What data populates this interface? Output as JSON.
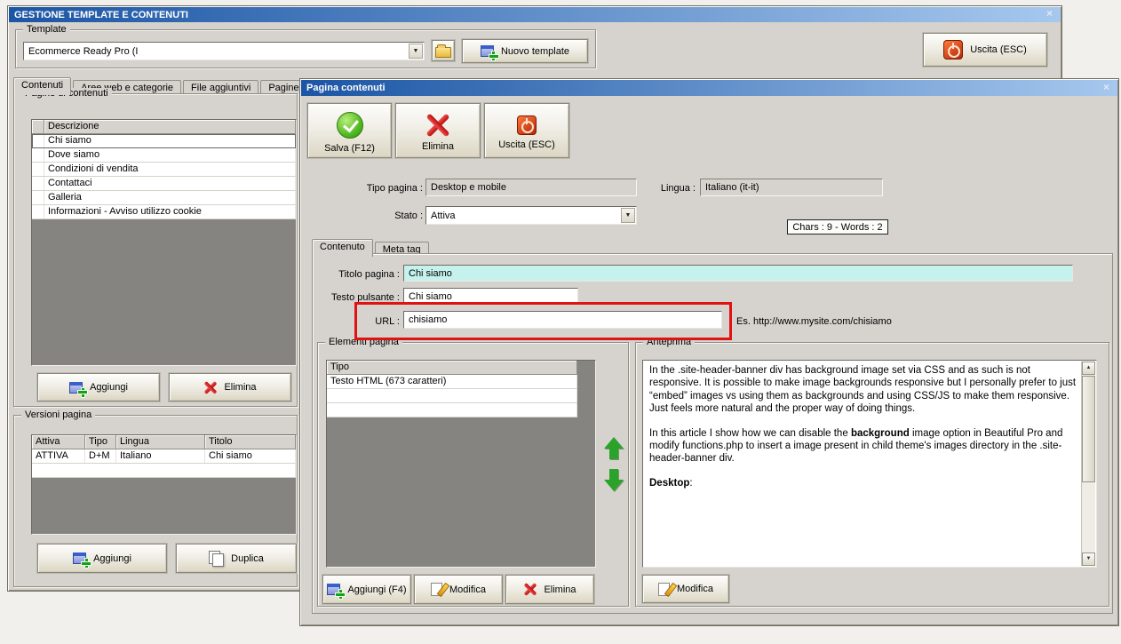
{
  "icons": {
    "close": "×",
    "dropdown": "▼",
    "scroll_up": "▲",
    "scroll_down": "▼"
  },
  "window": {
    "title": "GESTIONE TEMPLATE E CONTENUTI",
    "template": {
      "group_label": "Template",
      "combo_value": "Ecommerce Ready Pro (I",
      "nuovo_button": "Nuovo template",
      "uscita_button": "Uscita (ESC)"
    },
    "tabs": [
      "Contenuti",
      "Aree web e categorie",
      "File aggiuntivi",
      "Pagine di c"
    ],
    "pagine": {
      "group_label": "Pagine di contenuti",
      "col_descrizione": "Descrizione",
      "rows": [
        "Chi siamo",
        "Dove siamo",
        "Condizioni di vendita",
        "Contattaci",
        "Galleria",
        "Informazioni - Avviso utilizzo cookie"
      ],
      "aggiungi_button": "Aggiungi",
      "elimina_button": "Elimina"
    },
    "versioni": {
      "group_label": "Versioni pagina",
      "cols": [
        "Attiva",
        "Tipo",
        "Lingua",
        "Titolo"
      ],
      "row": [
        "ATTIVA",
        "D+M",
        "Italiano",
        "Chi siamo"
      ],
      "aggiungi_button": "Aggiungi",
      "duplica_button": "Duplica"
    }
  },
  "dialog": {
    "title": "Pagina contenuti",
    "toolbar": {
      "salva": "Salva (F12)",
      "elimina": "Elimina",
      "uscita": "Uscita (ESC)"
    },
    "fields": {
      "tipo_pagina_label": "Tipo pagina :",
      "tipo_pagina_value": "Desktop e mobile",
      "lingua_label": "Lingua :",
      "lingua_value": "Italiano (it-it)",
      "stato_label": "Stato :",
      "stato_value": "Attiva",
      "counter": "Chars : 9 - Words : 2"
    },
    "tabs": [
      "Contenuto",
      "Meta tag"
    ],
    "contenuto": {
      "titolo_label": "Titolo pagina :",
      "titolo_value": "Chi siamo",
      "testo_label": "Testo pulsante :",
      "testo_value": "Chi siamo",
      "url_label": "URL :",
      "url_value": "chisiamo",
      "url_hint": "Es. http://www.mysite.com/chisiamo"
    },
    "elementi": {
      "group_label": "Elementi pagina",
      "col_tipo": "Tipo",
      "rows": [
        "Testo HTML (673 caratteri)"
      ],
      "aggiungi_button": "Aggiungi (F4)",
      "modifica_button": "Modifica",
      "elimina_button": "Elimina"
    },
    "anteprima": {
      "group_label": "Anteprima",
      "p1": "In the .site-header-banner div has background image set via CSS and as such is not responsive. It is possible to make image backgrounds responsive but I personally prefer to just “embed” images vs using them as backgrounds and using CSS/JS to make them responsive. Just feels more natural and the proper way of doing things.",
      "p2_a": "In this article I show how we can disable the ",
      "p2_bold": "background",
      "p2_c": " image option in Beautiful Pro and modify functions.php to insert a image present in child theme's images directory in the .site-header-banner div.",
      "p3_bold": "Desktop",
      "p3_b": ":",
      "modifica_button": "Modifica"
    }
  }
}
